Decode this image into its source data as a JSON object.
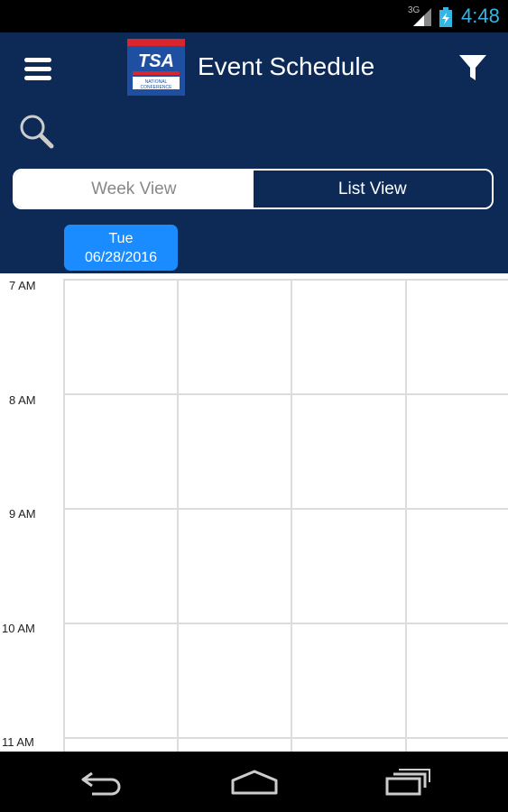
{
  "status_bar": {
    "network": "3G",
    "time": "4:48"
  },
  "header": {
    "title": "Event Schedule",
    "logo_text": "TSA",
    "logo_subtext": "NATIONAL CONFERENCE"
  },
  "view_toggle": {
    "week_label": "Week View",
    "list_label": "List View",
    "selected": "List View"
  },
  "date_chip": {
    "day": "Tue",
    "date": "06/28/2016"
  },
  "schedule": {
    "time_labels": [
      "7 AM",
      "8 AM",
      "9 AM",
      "10 AM",
      "11 AM"
    ]
  },
  "colors": {
    "header_bg": "#0d2a56",
    "accent": "#1a8cff",
    "status_time": "#33b5e5"
  },
  "icons": [
    "menu-icon",
    "filter-icon",
    "search-icon",
    "back-icon",
    "home-icon",
    "recent-apps-icon"
  ]
}
